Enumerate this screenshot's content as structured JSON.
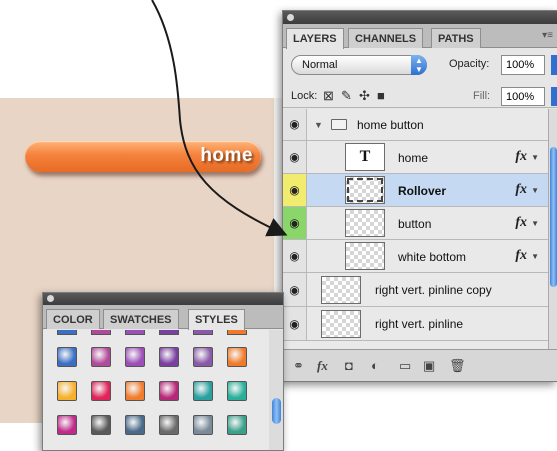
{
  "canvas": {
    "button_label": "home",
    "colors": {
      "background": "#e9d5c6",
      "button": "#f4823c"
    }
  },
  "layers_panel": {
    "tabs": [
      {
        "label": "LAYERS",
        "active": true
      },
      {
        "label": "CHANNELS",
        "active": false
      },
      {
        "label": "PATHS",
        "active": false
      }
    ],
    "blend_mode": "Normal",
    "opacity_label": "Opacity:",
    "opacity_value": "100%",
    "lock_label": "Lock:",
    "fill_label": "Fill:",
    "fill_value": "100%",
    "layers": [
      {
        "name": "home button",
        "type": "group",
        "fx": false,
        "eye_highlight": "none"
      },
      {
        "name": "home",
        "type": "text",
        "thumb_text": "T",
        "fx": true,
        "eye_highlight": "none"
      },
      {
        "name": "Rollover",
        "type": "layer",
        "fx": true,
        "selected": true,
        "eye_highlight": "yellow"
      },
      {
        "name": "button",
        "type": "layer",
        "fx": true,
        "eye_highlight": "green"
      },
      {
        "name": "white bottom",
        "type": "layer",
        "fx": true,
        "eye_highlight": "none"
      },
      {
        "name": "right vert. pinline copy",
        "type": "layer",
        "fx": false,
        "eye_highlight": "none"
      },
      {
        "name": "right vert. pinline",
        "type": "layer",
        "fx": false,
        "eye_highlight": "none"
      }
    ],
    "fx_label": "fx",
    "footer_icons": [
      "link-icon",
      "fx-icon",
      "mask-icon",
      "adjustment-icon",
      "folder-icon",
      "new-layer-icon",
      "trash-icon"
    ]
  },
  "styles_panel": {
    "tabs": [
      {
        "label": "COLOR",
        "active": false
      },
      {
        "label": "SWATCHES",
        "active": false
      },
      {
        "label": "STYLES",
        "active": true
      }
    ],
    "swatch_rows": [
      [
        "#3a6fc4",
        "#b04a9a",
        "#9c4fb8",
        "#7a3fa0",
        "#8a5aa8",
        "#ef7a2a"
      ],
      [
        "#f7b02a",
        "#e0245a",
        "#f07c2c",
        "#b8287a",
        "#2aa0a0",
        "#2ab09a"
      ],
      [
        "#c02a8a",
        "#5a5a5a",
        "#4a6a8a",
        "#6a6a6a",
        "#7a8a9a",
        "#3aa08a"
      ]
    ]
  }
}
